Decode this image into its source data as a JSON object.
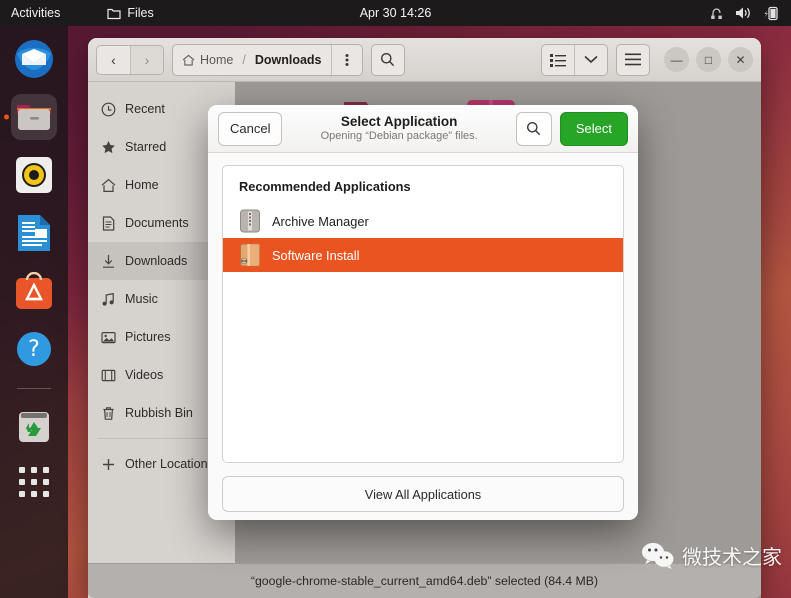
{
  "topbar": {
    "activities": "Activities",
    "app_name": "Files",
    "clock": "Apr 30  14:26",
    "tray": [
      "network-icon",
      "volume-icon",
      "battery-icon"
    ]
  },
  "dock": {
    "items": [
      {
        "name": "thunderbird",
        "label": "Thunderbird Mail"
      },
      {
        "name": "files",
        "label": "Files",
        "active": true
      },
      {
        "name": "rhythmbox",
        "label": "Rhythmbox"
      },
      {
        "name": "libreoffice-writer",
        "label": "LibreOffice Writer"
      },
      {
        "name": "ubuntu-software",
        "label": "Ubuntu Software"
      },
      {
        "name": "help",
        "label": "Help"
      },
      {
        "name": "rubbish-bin",
        "label": "Rubbish Bin"
      },
      {
        "name": "show-applications",
        "label": "Show Applications"
      }
    ]
  },
  "file_manager": {
    "nav": {
      "back": "‹",
      "forward": "›"
    },
    "breadcrumb": {
      "home": "Home",
      "separator": "/",
      "current": "Downloads"
    },
    "buttons": {
      "path_menu": "path-menu-icon",
      "search": "search-icon",
      "view_list": "list-view-icon",
      "view_chevron": "chevron-down-icon",
      "hamburger": "hamburger-menu-icon",
      "minimize": "—",
      "maximize": "□",
      "close": "✕"
    },
    "sidebar": [
      {
        "label": "Recent",
        "icon": "clock-icon"
      },
      {
        "label": "Starred",
        "icon": "star-icon"
      },
      {
        "label": "Home",
        "icon": "home-icon"
      },
      {
        "label": "Documents",
        "icon": "document-icon"
      },
      {
        "label": "Downloads",
        "icon": "download-icon",
        "selected": true
      },
      {
        "label": "Music",
        "icon": "music-note-icon"
      },
      {
        "label": "Pictures",
        "icon": "picture-icon"
      },
      {
        "label": "Videos",
        "icon": "film-icon"
      },
      {
        "label": "Rubbish Bin",
        "icon": "trash-icon"
      },
      {
        "label": "Other Locations",
        "icon": "plus-icon"
      }
    ],
    "status": "“google-chrome-stable_current_amd64.deb” selected (84.4 MB)"
  },
  "dialog": {
    "cancel_label": "Cancel",
    "title": "Select Application",
    "subtitle": "Opening “Debian package” files.",
    "search_icon": "search-icon",
    "select_label": "Select",
    "list_title": "Recommended Applications",
    "apps": [
      {
        "label": "Archive Manager",
        "icon": "archive-manager-icon",
        "selected": false
      },
      {
        "label": "Software Install",
        "icon": "software-install-icon",
        "selected": true
      }
    ],
    "view_all_label": "View All Applications"
  },
  "watermark": {
    "text": "微技术之家"
  },
  "colors": {
    "accent_orange": "#e95420",
    "select_green": "#26a526",
    "topbar_bg": "#1d1a1b",
    "sidebar_bg": "#d6d2ce"
  }
}
